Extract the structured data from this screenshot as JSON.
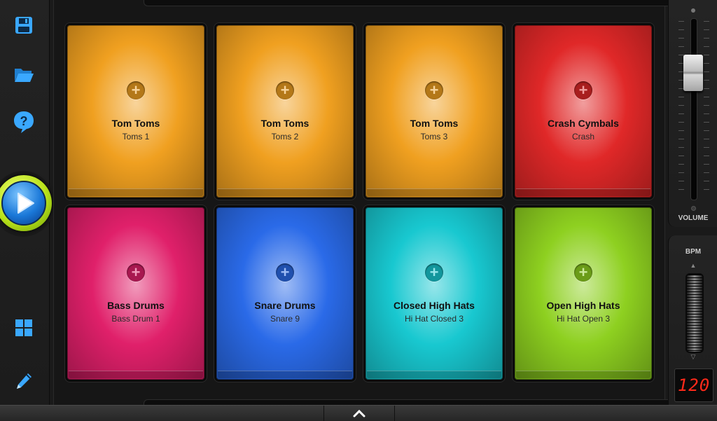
{
  "toolbar": {
    "icons": [
      "save-icon",
      "folder-open-icon",
      "help-icon",
      "play-icon",
      "grid-icon",
      "pencil-icon"
    ],
    "accent": "#3aa8ff"
  },
  "pads": [
    {
      "title": "Tom Toms",
      "sample": "Toms 1",
      "color": "#f0a020"
    },
    {
      "title": "Tom Toms",
      "sample": "Toms 2",
      "color": "#f0a020"
    },
    {
      "title": "Tom Toms",
      "sample": "Toms 3",
      "color": "#f0a020"
    },
    {
      "title": "Crash Cymbals",
      "sample": "Crash",
      "color": "#e02828"
    },
    {
      "title": "Bass Drums",
      "sample": "Bass Drum 1",
      "color": "#e0206a"
    },
    {
      "title": "Snare Drums",
      "sample": "Snare 9",
      "color": "#2a6ae8"
    },
    {
      "title": "Closed High Hats",
      "sample": "Hi Hat Closed 3",
      "color": "#18c8d0"
    },
    {
      "title": "Open High Hats",
      "sample": "Hi Hat Open 3",
      "color": "#8ed020"
    }
  ],
  "volume": {
    "label": "VOLUME",
    "level": 0.75
  },
  "bpm": {
    "label": "BPM",
    "value": "120",
    "display_color": "#ff2a1a"
  }
}
